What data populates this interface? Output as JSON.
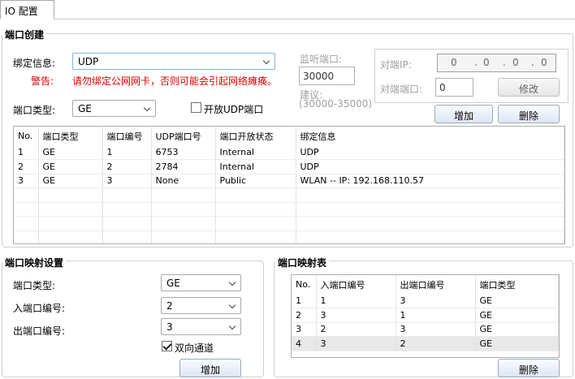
{
  "tab": {
    "label": "IO 配置"
  },
  "create": {
    "legend": "端口创建",
    "bind_label": "绑定信息:",
    "bind_value": "UDP",
    "warn_label": "警告:",
    "warn_text": "请勿绑定公网网卡，否则可能会引起网络瘫痪。",
    "port_type_label": "端口类型:",
    "port_type_value": "GE",
    "open_udp_label": "开放UDP端口",
    "open_udp_checked": false,
    "listen_label": "监听端口:",
    "listen_value": "30000",
    "suggest_label": "建议:",
    "suggest_range": "(30000-35000)",
    "peer_ip_label": "对端IP:",
    "peer_ip_parts": [
      "0",
      "0",
      "0",
      "0"
    ],
    "peer_port_label": "对端端口:",
    "peer_port_value": "0",
    "modify_label": "修改",
    "add_label": "增加",
    "delete_label": "删除",
    "table": {
      "headers": [
        "No.",
        "端口类型",
        "端口编号",
        "UDP端口号",
        "端口开放状态",
        "绑定信息"
      ],
      "rows": [
        [
          "1",
          "GE",
          "1",
          "6753",
          "Internal",
          "UDP"
        ],
        [
          "2",
          "GE",
          "2",
          "2784",
          "Internal",
          "UDP"
        ],
        [
          "3",
          "GE",
          "3",
          "None",
          "Public",
          "WLAN -- IP: 192.168.110.57"
        ]
      ]
    }
  },
  "mapset": {
    "legend": "端口映射设置",
    "type_label": "端口类型:",
    "type_value": "GE",
    "in_label": "入端口编号:",
    "in_value": "2",
    "out_label": "出端口编号:",
    "out_value": "3",
    "bidir_label": "双向通道",
    "bidir_checked": true,
    "add_label": "增加"
  },
  "maptable": {
    "legend": "端口映射表",
    "headers": [
      "No.",
      "入端口编号",
      "出端口编号",
      "端口类型"
    ],
    "rows": [
      [
        "1",
        "1",
        "3",
        "GE"
      ],
      [
        "2",
        "3",
        "1",
        "GE"
      ],
      [
        "3",
        "2",
        "3",
        "GE"
      ],
      [
        "4",
        "3",
        "2",
        "GE"
      ]
    ],
    "delete_label": "删除"
  }
}
